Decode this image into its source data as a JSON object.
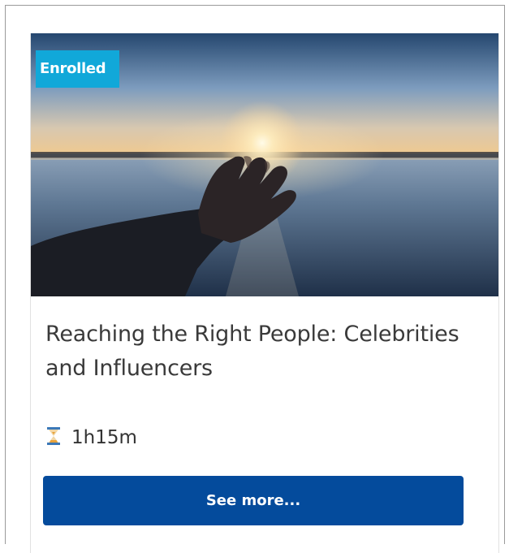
{
  "course_card": {
    "badge": "Enrolled",
    "title": "Reaching the Right People: Celebrities and Influencers",
    "duration": "1h15m",
    "duration_icon": "hourglass-icon",
    "button_label": "See more...",
    "colors": {
      "badge_bg": "#11a8d9",
      "button_bg": "#044b9c",
      "hourglass": "#e8a23a"
    }
  }
}
